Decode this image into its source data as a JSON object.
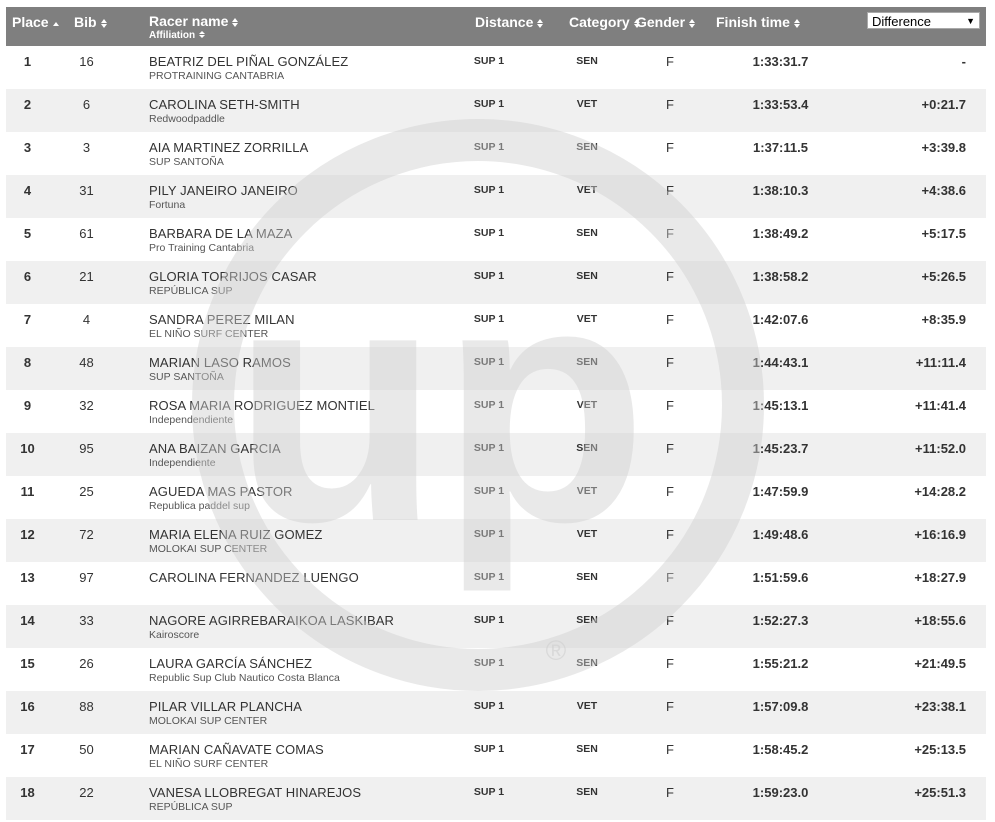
{
  "headers": {
    "place": "Place",
    "bib": "Bib",
    "racer_name": "Racer name",
    "affiliation": "Affiliation",
    "distance": "Distance",
    "category": "Category",
    "gender": "Gender",
    "finish_time": "Finish time",
    "difference_select": "Difference"
  },
  "watermark": {
    "text": "up",
    "registered_mark": "®",
    "color": "#d0d0d0"
  },
  "rows": [
    {
      "place": "1",
      "bib": "16",
      "name": "BEATRIZ DEL PIÑAL GONZÁLEZ",
      "affiliation": "PROTRAINING CANTABRIA",
      "distance": "SUP 1",
      "category": "SEN",
      "gender": "F",
      "finish": "1:33:31.7",
      "diff": "-"
    },
    {
      "place": "2",
      "bib": "6",
      "name": "CAROLINA SETH-SMITH",
      "affiliation": "Redwoodpaddle",
      "distance": "SUP 1",
      "category": "VET",
      "gender": "F",
      "finish": "1:33:53.4",
      "diff": "+0:21.7"
    },
    {
      "place": "3",
      "bib": "3",
      "name": "AIA MARTINEZ ZORRILLA",
      "affiliation": "SUP SANTOÑA",
      "distance": "SUP 1",
      "category": "SEN",
      "gender": "F",
      "finish": "1:37:11.5",
      "diff": "+3:39.8"
    },
    {
      "place": "4",
      "bib": "31",
      "name": "PILY JANEIRO JANEIRO",
      "affiliation": "Fortuna",
      "distance": "SUP 1",
      "category": "VET",
      "gender": "F",
      "finish": "1:38:10.3",
      "diff": "+4:38.6"
    },
    {
      "place": "5",
      "bib": "61",
      "name": "BARBARA DE LA MAZA",
      "affiliation": "Pro Training Cantabria",
      "distance": "SUP 1",
      "category": "SEN",
      "gender": "F",
      "finish": "1:38:49.2",
      "diff": "+5:17.5"
    },
    {
      "place": "6",
      "bib": "21",
      "name": "GLORIA TORRIJOS CASAR",
      "affiliation": "REPÚBLICA SUP",
      "distance": "SUP 1",
      "category": "SEN",
      "gender": "F",
      "finish": "1:38:58.2",
      "diff": "+5:26.5"
    },
    {
      "place": "7",
      "bib": "4",
      "name": "SANDRA PEREZ MILAN",
      "affiliation": "EL NIÑO SURF CENTER",
      "distance": "SUP 1",
      "category": "VET",
      "gender": "F",
      "finish": "1:42:07.6",
      "diff": "+8:35.9"
    },
    {
      "place": "8",
      "bib": "48",
      "name": "MARIAN LASO RAMOS",
      "affiliation": "SUP SANTOÑA",
      "distance": "SUP 1",
      "category": "SEN",
      "gender": "F",
      "finish": "1:44:43.1",
      "diff": "+11:11.4"
    },
    {
      "place": "9",
      "bib": "32",
      "name": "ROSA MARIA RODRIGUEZ MONTIEL",
      "affiliation": "Independendiente",
      "distance": "SUP 1",
      "category": "VET",
      "gender": "F",
      "finish": "1:45:13.1",
      "diff": "+11:41.4"
    },
    {
      "place": "10",
      "bib": "95",
      "name": "ANA BAIZAN GARCIA",
      "affiliation": "Independiente",
      "distance": "SUP 1",
      "category": "SEN",
      "gender": "F",
      "finish": "1:45:23.7",
      "diff": "+11:52.0"
    },
    {
      "place": "11",
      "bib": "25",
      "name": "AGUEDA MAS PASTOR",
      "affiliation": "Republica paddel sup",
      "distance": "SUP 1",
      "category": "VET",
      "gender": "F",
      "finish": "1:47:59.9",
      "diff": "+14:28.2"
    },
    {
      "place": "12",
      "bib": "72",
      "name": "MARIA ELENA RUIZ GOMEZ",
      "affiliation": "MOLOKAI SUP CENTER",
      "distance": "SUP 1",
      "category": "VET",
      "gender": "F",
      "finish": "1:49:48.6",
      "diff": "+16:16.9"
    },
    {
      "place": "13",
      "bib": "97",
      "name": "CAROLINA FERNANDEZ LUENGO",
      "affiliation": "",
      "distance": "SUP 1",
      "category": "SEN",
      "gender": "F",
      "finish": "1:51:59.6",
      "diff": "+18:27.9"
    },
    {
      "place": "14",
      "bib": "33",
      "name": "NAGORE AGIRREBARAIKOA LASKIBAR",
      "affiliation": "Kairoscore",
      "distance": "SUP 1",
      "category": "SEN",
      "gender": "F",
      "finish": "1:52:27.3",
      "diff": "+18:55.6"
    },
    {
      "place": "15",
      "bib": "26",
      "name": "LAURA GARCÍA SÁNCHEZ",
      "affiliation": "Republic Sup Club Nautico Costa Blanca",
      "distance": "SUP 1",
      "category": "SEN",
      "gender": "F",
      "finish": "1:55:21.2",
      "diff": "+21:49.5"
    },
    {
      "place": "16",
      "bib": "88",
      "name": "PILAR VILLAR PLANCHA",
      "affiliation": "MOLOKAI SUP CENTER",
      "distance": "SUP 1",
      "category": "VET",
      "gender": "F",
      "finish": "1:57:09.8",
      "diff": "+23:38.1"
    },
    {
      "place": "17",
      "bib": "50",
      "name": "MARIAN CAÑAVATE COMAS",
      "affiliation": "EL NIÑO SURF CENTER",
      "distance": "SUP 1",
      "category": "SEN",
      "gender": "F",
      "finish": "1:58:45.2",
      "diff": "+25:13.5"
    },
    {
      "place": "18",
      "bib": "22",
      "name": "VANESA LLOBREGAT HINAREJOS",
      "affiliation": "REPÚBLICA SUP",
      "distance": "SUP 1",
      "category": "SEN",
      "gender": "F",
      "finish": "1:59:23.0",
      "diff": "+25:51.3"
    }
  ]
}
